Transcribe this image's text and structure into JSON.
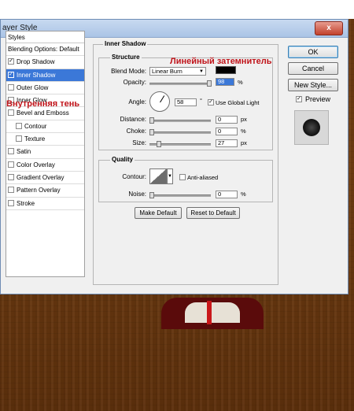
{
  "window": {
    "title": "ayer Style",
    "close_symbol": "x"
  },
  "annotations": {
    "inner_shadow_ru": "Внутренняя тень",
    "linear_burn_ru": "Линейный затемнитель"
  },
  "stylelist": {
    "header": "Styles",
    "blending": "Blending Options: Default",
    "items": [
      {
        "label": "Drop Shadow",
        "checked": true
      },
      {
        "label": "Inner Shadow",
        "checked": true,
        "selected": true
      },
      {
        "label": "Outer Glow",
        "checked": false
      },
      {
        "label": "Inner Glow",
        "checked": false
      },
      {
        "label": "Bevel and Emboss",
        "checked": false
      },
      {
        "label": "Contour",
        "checked": false,
        "indent": true
      },
      {
        "label": "Texture",
        "checked": false,
        "indent": true
      },
      {
        "label": "Satin",
        "checked": false
      },
      {
        "label": "Color Overlay",
        "checked": false
      },
      {
        "label": "Gradient Overlay",
        "checked": false
      },
      {
        "label": "Pattern Overlay",
        "checked": false
      },
      {
        "label": "Stroke",
        "checked": false
      }
    ]
  },
  "panel": {
    "title": "Inner Shadow",
    "structure": {
      "title": "Structure",
      "blend_mode_label": "Blend Mode:",
      "blend_mode_value": "Linear Burn",
      "shadow_color": "#000000",
      "opacity_label": "Opacity:",
      "opacity_value": "98",
      "opacity_fraction": 0.98,
      "angle_label": "Angle:",
      "angle_value": "58",
      "angle_unit": "°",
      "use_global_light_label": "Use Global Light",
      "use_global_light": true,
      "distance_label": "Distance:",
      "distance_value": "0",
      "distance_fraction": 0.0,
      "choke_label": "Choke:",
      "choke_value": "0",
      "choke_fraction": 0.0,
      "size_label": "Size:",
      "size_value": "27",
      "size_fraction": 0.11,
      "unit_percent": "%",
      "unit_px": "px"
    },
    "quality": {
      "title": "Quality",
      "contour_label": "Contour:",
      "anti_aliased_label": "Anti-aliased",
      "anti_aliased": false,
      "noise_label": "Noise:",
      "noise_value": "0",
      "noise_fraction": 0.0
    },
    "make_default": "Make Default",
    "reset_default": "Reset to Default"
  },
  "right": {
    "ok": "OK",
    "cancel": "Cancel",
    "new_style": "New Style...",
    "preview_label": "Preview",
    "preview": true
  }
}
